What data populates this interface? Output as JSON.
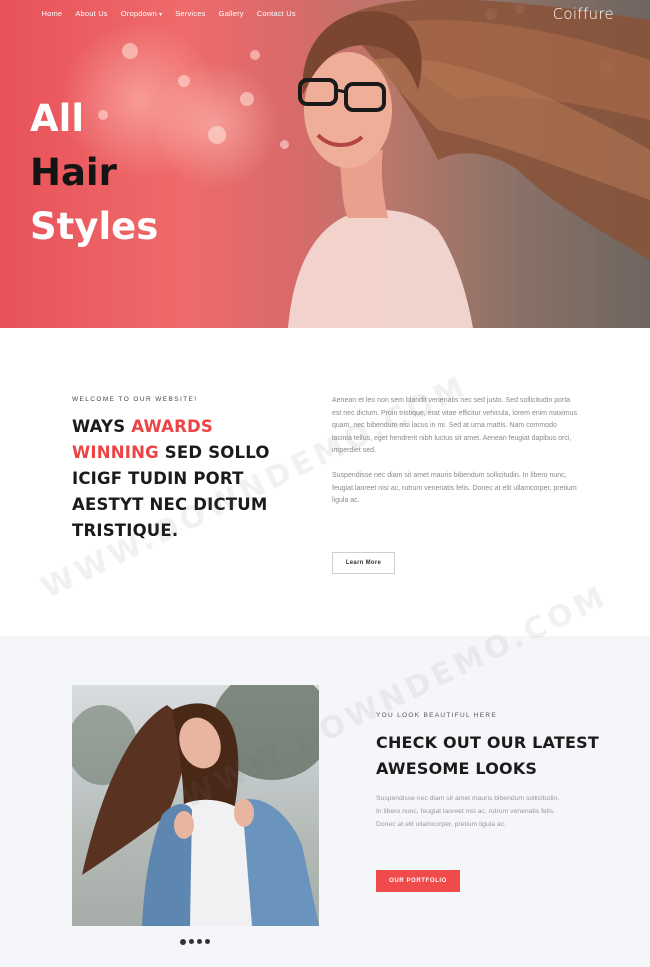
{
  "nav": {
    "items": [
      "Home",
      "About Us",
      "Oropdown",
      "Services",
      "Gallery",
      "Contact Us"
    ],
    "dropdown_caret": "▾"
  },
  "brand": "Coiffure",
  "hero": {
    "title_lines": [
      "All",
      "Hair",
      "Styles"
    ]
  },
  "about": {
    "welcome_label": "WELCOME TO OUR WEBSITE!",
    "heading_pre": "WAYS ",
    "heading_accent_1": "AWARDS",
    "heading_accent_2": "WINNING",
    "heading_rest": " SED SOLLO ICIGF TUDIN PORT AESTYT NEC DICTUM TRISTIQUE.",
    "paragraph_1": "Aenean et leo non sem blandit venenatis nec sed justo. Sed sollicitudin porta est nec dictum. Proin tristique, erat vitae efficitur vehicula, lorem enim maximus quam, nec bibendum nisi lacus in mi. Sed at urna mattis. Nam commodo lacinia tellus, eget hendrerit nibh luctus sit amet. Aenean feugiat dapibus orci, imperdiet sed.",
    "paragraph_2": "Suspendisse nec diam sit amet mauris bibendum sollicitudin. In libero nunc, feugiat laoreet nisi ac, rutrum venenatis felis. Donec at elit ullamcorper, pretium ligula ac.",
    "button_label": "Learn More"
  },
  "portfolio": {
    "sub_label": "YOU LOOK BEAUTIFUL HERE",
    "heading": "CHECK OUT OUR LATEST AWESOME LOOKS",
    "paragraph": "Suspendisse nec diam sit amet mauris bibendum sollicitudin. In libero nunc, feugiat laoreet nisi ac, rutrum venenatis felis. Donec at elit ullamcorper, pretium ligula ac.",
    "button_label": "OUR PORTFOLIO",
    "slider_dots": 4,
    "active_dot": 0
  },
  "watermark": "WWW.DOWNDEMO.COM",
  "colors": {
    "accent": "#ec4444",
    "button_red": "#f04a4a",
    "hero_overlay": "#ef6a6a",
    "section_bg": "#f4f6f9"
  }
}
